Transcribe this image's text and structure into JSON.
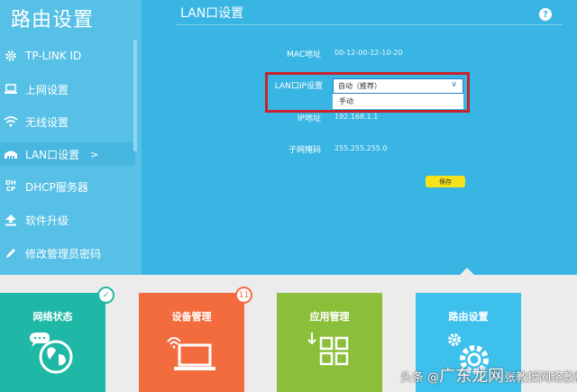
{
  "sidebar": {
    "title": "路由设置",
    "items": [
      {
        "label": "TP-LINK ID",
        "icon": "gear-icon"
      },
      {
        "label": "上网设置",
        "icon": "laptop-icon"
      },
      {
        "label": "无线设置",
        "icon": "wifi-icon"
      },
      {
        "label": "LAN口设置",
        "icon": "lan-icon",
        "active": true,
        "arrow": ">"
      },
      {
        "label": "DHCP服务器",
        "icon": "dhcp-icon"
      },
      {
        "label": "软件升级",
        "icon": "upload-icon"
      },
      {
        "label": "修改管理员密码",
        "icon": "pencil-icon"
      }
    ],
    "dhcp_icon_text": "DH CP"
  },
  "main": {
    "title": "LAN口设置",
    "help": "?",
    "mac_label": "MAC地址",
    "mac_value": "00-12-00-12-10-20",
    "lan_ip_label": "LAN口IP设置",
    "lan_ip_selected": "自动（推荐）",
    "lan_ip_option": "手动",
    "ip_label": "IP地址",
    "ip_value": "192.168.1.1",
    "mask_label": "子网掩码",
    "mask_value": "255.255.255.0",
    "save_label": "保存"
  },
  "tiles": [
    {
      "label": "网络状态",
      "color": "#1fb8a6",
      "badge": "✓"
    },
    {
      "label": "设备管理",
      "color": "#f36c3d",
      "badge": "11"
    },
    {
      "label": "应用管理",
      "color": "#8bbf3a"
    },
    {
      "label": "路由设置",
      "color": "#3dc0ec"
    }
  ],
  "watermark": {
    "prefix": "头条 @",
    "brand": "广东龙网",
    "text": "张教授网络教程"
  },
  "colors": {
    "background": "#39b5e3",
    "highlight": "#c8232c",
    "save": "#f5e21b"
  }
}
